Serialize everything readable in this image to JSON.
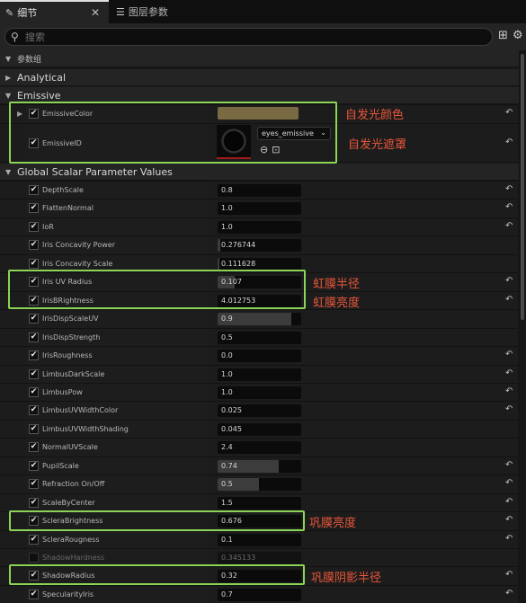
{
  "tabs": [
    {
      "label": "细节",
      "icon": "pencil-icon",
      "active": true
    },
    {
      "label": "图层参数",
      "icon": "layers-icon",
      "active": false
    }
  ],
  "close_glyph": "✕",
  "search": {
    "placeholder": "搜索",
    "value": ""
  },
  "categories": {
    "param_group": "参数组",
    "analytical": "Analytical",
    "emissive": "Emissive",
    "global_scalar": "Global Scalar Parameter Values"
  },
  "emissive": {
    "color_name": "EmissiveColor",
    "color_value": "#7a6a43",
    "id_name": "EmissiveID",
    "texture": "eyes_emissive"
  },
  "params": [
    {
      "name": "DepthScale",
      "value": "0.8",
      "fill": 0,
      "reset": true
    },
    {
      "name": "FlattenNormal",
      "value": "1.0",
      "fill": 0,
      "reset": true
    },
    {
      "name": "IoR",
      "value": "1.0",
      "fill": 0,
      "reset": true
    },
    {
      "name": "Iris Concavity Power",
      "value": "0.276744",
      "fill": 0.03,
      "reset": false
    },
    {
      "name": "Iris Concavity Scale",
      "value": "0.111628",
      "fill": 0.02,
      "reset": false
    },
    {
      "name": "Iris UV Radius",
      "value": "0.107",
      "fill": 0.2,
      "reset": true
    },
    {
      "name": "IrisBRightness",
      "value": "4.012753",
      "fill": 0,
      "reset": true
    },
    {
      "name": "IrisDispScaleUV",
      "value": "0.9",
      "fill": 0.88,
      "reset": false
    },
    {
      "name": "IrisDispStrength",
      "value": "0.5",
      "fill": 0,
      "reset": false
    },
    {
      "name": "IrisRoughness",
      "value": "0.0",
      "fill": 0,
      "reset": true
    },
    {
      "name": "LimbusDarkScale",
      "value": "1.0",
      "fill": 0,
      "reset": true
    },
    {
      "name": "LimbusPow",
      "value": "1.0",
      "fill": 0,
      "reset": true
    },
    {
      "name": "LimbusUVWidthColor",
      "value": "0.025",
      "fill": 0,
      "reset": true
    },
    {
      "name": "LimbusUVWidthShading",
      "value": "0.045",
      "fill": 0,
      "reset": false
    },
    {
      "name": "NormalUVScale",
      "value": "2.4",
      "fill": 0,
      "reset": false
    },
    {
      "name": "PupilScale",
      "value": "0.74",
      "fill": 0.73,
      "reset": true
    },
    {
      "name": "Refraction On/Off",
      "value": "0.5",
      "fill": 0.49,
      "reset": true
    },
    {
      "name": "ScaleByCenter",
      "value": "1.5",
      "fill": 0,
      "reset": true
    },
    {
      "name": "ScleraBrightness",
      "value": "0.676",
      "fill": 0,
      "reset": true
    },
    {
      "name": "ScleraRougness",
      "value": "0.1",
      "fill": 0,
      "reset": true
    },
    {
      "name": "ShadowHardness",
      "value": "0.345133",
      "fill": 0,
      "reset": false,
      "disabled": true
    },
    {
      "name": "ShadowRadius",
      "value": "0.32",
      "fill": 0,
      "reset": true
    },
    {
      "name": "SpecularityIris",
      "value": "0.7",
      "fill": 0,
      "reset": true
    }
  ],
  "annotations": {
    "emissive_color": "自发光颜色",
    "emissive_mask": "自发光遮罩",
    "iris_radius": "虹膜半径",
    "iris_brightness": "虹膜亮度",
    "sclera_brightness": "巩膜亮度",
    "sclera_shadow_radius": "巩膜阴影半径"
  },
  "colors": {
    "highlight": "#8bd455",
    "annotation": "#e8563a"
  }
}
